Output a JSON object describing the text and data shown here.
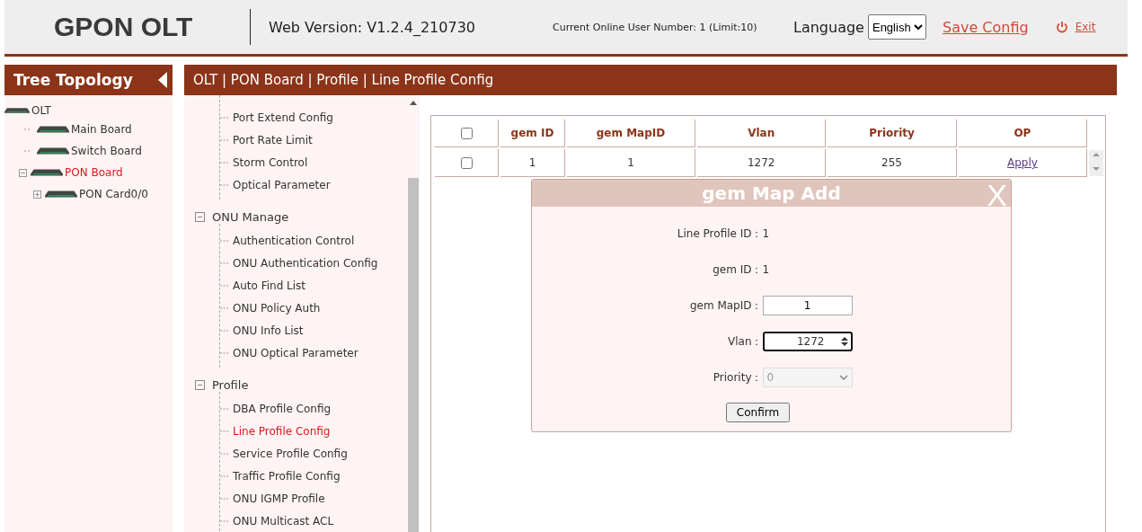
{
  "header": {
    "title": "GPON OLT",
    "version": "Web Version: V1.2.4_210730",
    "online_users": "Current Online User Number: 1 (Limit:10)",
    "language_label": "Language",
    "language": "English",
    "save": "Save Config",
    "exit": "Exit"
  },
  "topology": {
    "title": "Tree Topology",
    "tree": [
      {
        "label": "OLT",
        "selected": false,
        "children": [
          {
            "label": "Main Board",
            "selected": false
          },
          {
            "label": "Switch Board",
            "selected": false
          },
          {
            "label": "PON Board",
            "selected": true,
            "expanded": true,
            "children": [
              {
                "label": "PON Card0/0",
                "selected": false,
                "expanded": false
              }
            ]
          }
        ]
      }
    ]
  },
  "breadcrumb": "OLT | PON Board | Profile | Line Profile Config",
  "menu": [
    {
      "children": [
        {
          "label": "Port Extend Config",
          "selected": false
        },
        {
          "label": "Port Rate Limit",
          "selected": false
        },
        {
          "label": "Storm Control",
          "selected": false
        },
        {
          "label": "Optical Parameter",
          "selected": false
        }
      ]
    },
    {
      "label": "ONU Manage",
      "expanded": true,
      "children": [
        {
          "label": "Authentication Control",
          "selected": false
        },
        {
          "label": "ONU Authentication Config",
          "selected": false
        },
        {
          "label": "Auto Find List",
          "selected": false
        },
        {
          "label": "ONU Policy Auth",
          "selected": false
        },
        {
          "label": "ONU Info List",
          "selected": false
        },
        {
          "label": "ONU Optical Parameter",
          "selected": false
        }
      ]
    },
    {
      "label": "Profile",
      "expanded": true,
      "children": [
        {
          "label": "DBA Profile Config",
          "selected": false
        },
        {
          "label": "Line Profile Config",
          "selected": true
        },
        {
          "label": "Service Profile Config",
          "selected": false
        },
        {
          "label": "Traffic Profile Config",
          "selected": false
        },
        {
          "label": "ONU IGMP Profile",
          "selected": false
        },
        {
          "label": "ONU Multicast ACL",
          "selected": false
        }
      ]
    }
  ],
  "table": {
    "header_checked": false,
    "columns": [
      "gem ID",
      "gem MapID",
      "Vlan",
      "Priority",
      "OP"
    ],
    "rows": [
      {
        "checked": false,
        "cells": [
          "1",
          "1",
          "1272",
          "255"
        ],
        "action": "Apply"
      }
    ]
  },
  "dialog": {
    "title": "gem Map Add",
    "close": "X",
    "fields": [
      {
        "kind": "text",
        "label": "Line Profile ID：",
        "value": "1"
      },
      {
        "kind": "text",
        "label": "gem ID：",
        "value": "1"
      },
      {
        "kind": "input",
        "label": "gem MapID：",
        "value": "1"
      },
      {
        "kind": "spinner",
        "label": "Vlan：",
        "value": "1272"
      },
      {
        "kind": "select",
        "label": "Priority：",
        "value": "0",
        "disabled": true
      }
    ],
    "confirm": "Confirm"
  }
}
